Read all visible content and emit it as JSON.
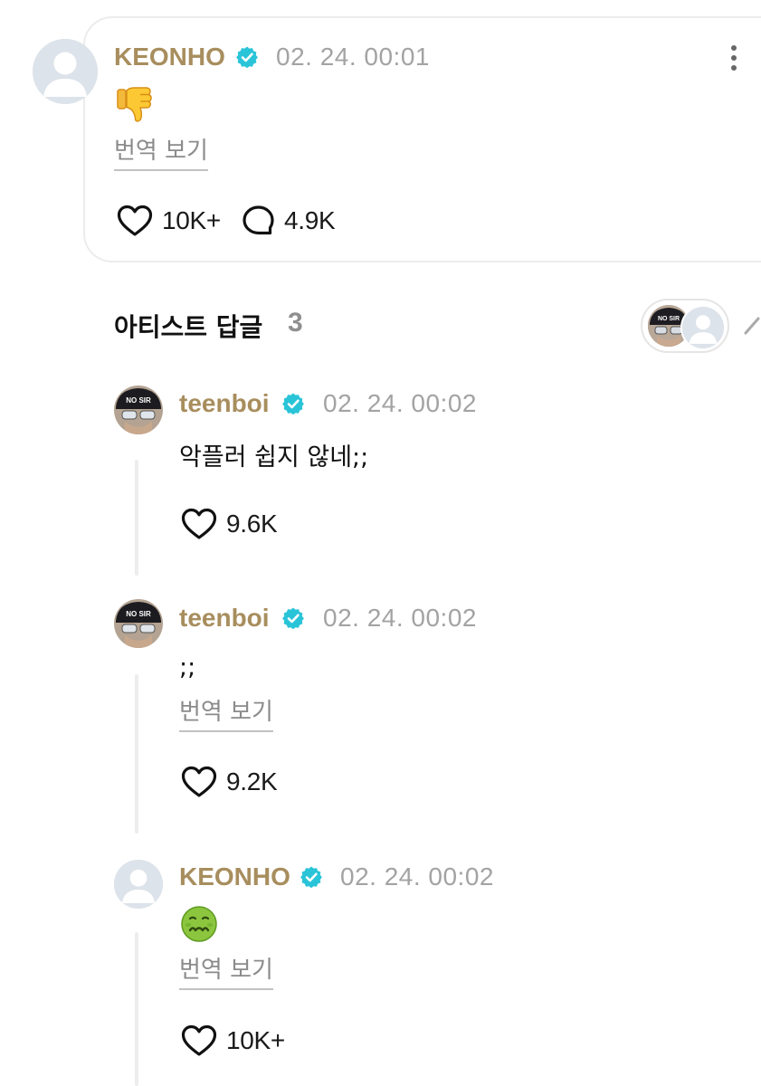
{
  "post": {
    "username": "KEONHO",
    "timestamp": "02. 24. 00:01",
    "content_emoji": "thumbs-down",
    "translate_label": "번역 보기",
    "likes": "10K+",
    "comments": "4.9K"
  },
  "artist_replies": {
    "title": "아티스트 답글",
    "count": "3",
    "avatar_text": "NO SIR"
  },
  "replies": [
    {
      "username": "teenboi",
      "timestamp": "02. 24. 00:02",
      "text": "악플러 쉽지 않네;;",
      "likes": "9.6K",
      "avatar_text": "NO SIR"
    },
    {
      "username": "teenboi",
      "timestamp": "02. 24. 00:02",
      "text": ";;",
      "translate_label": "번역 보기",
      "likes": "9.2K",
      "avatar_text": "NO SIR"
    },
    {
      "username": "KEONHO",
      "timestamp": "02. 24. 00:02",
      "content_emoji": "nauseated-face",
      "translate_label": "번역 보기",
      "likes": "10K+"
    }
  ],
  "colors": {
    "username": "#a88e5e",
    "verified_badge": "#2ac4d8",
    "timestamp": "#a3a3a3",
    "border": "#ececec"
  }
}
